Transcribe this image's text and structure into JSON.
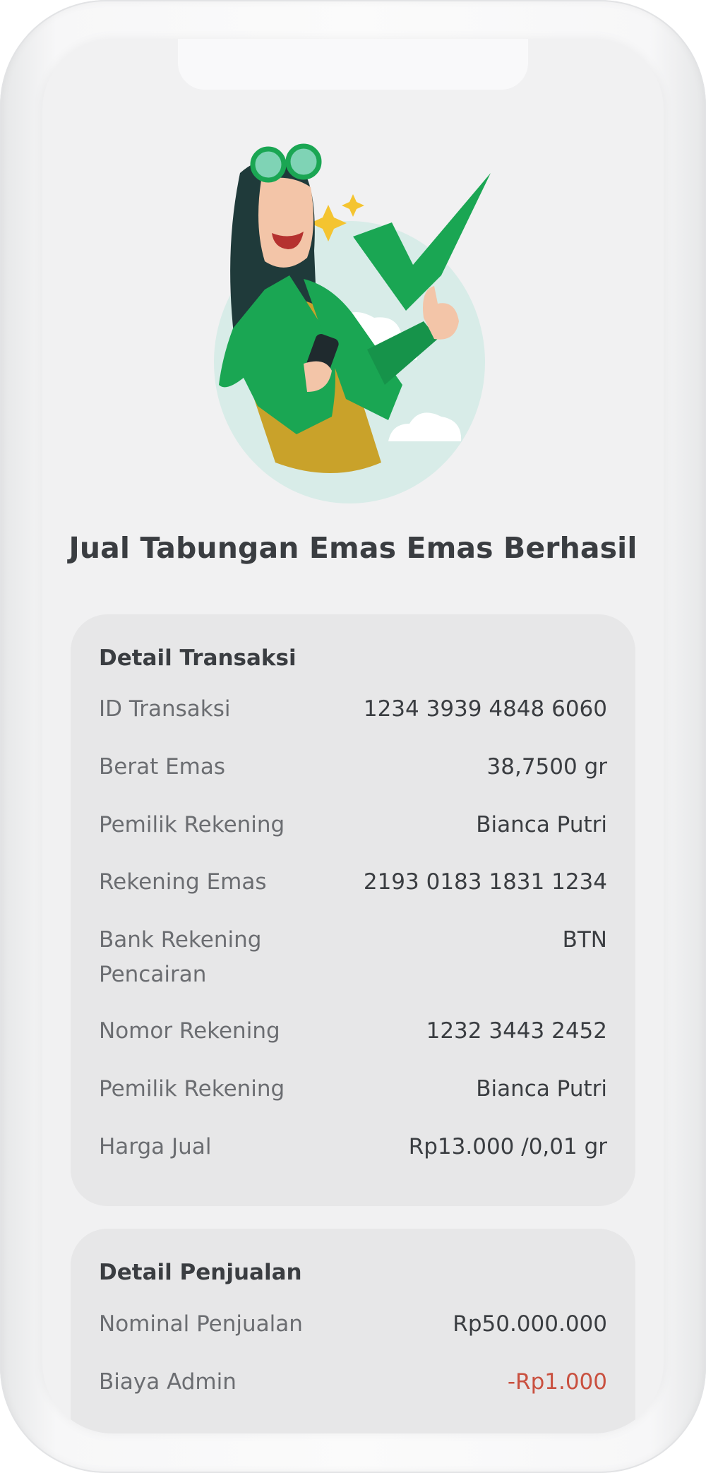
{
  "title": "Jual Tabungan Emas Emas Berhasil",
  "transaction": {
    "heading": "Detail Transaksi",
    "rows": [
      {
        "label": "ID Transaksi",
        "value": "1234 3939 4848 6060"
      },
      {
        "label": "Berat Emas",
        "value": "38,7500 gr"
      },
      {
        "label": "Pemilik Rekening",
        "value": "Bianca Putri"
      },
      {
        "label": "Rekening Emas",
        "value": "2193 0183 1831 1234"
      },
      {
        "label": "Bank Rekening Pencairan",
        "value": "BTN"
      },
      {
        "label": "Nomor Rekening",
        "value": "1232 3443 2452"
      },
      {
        "label": "Pemilik Rekening",
        "value": "Bianca Putri"
      },
      {
        "label": "Harga Jual",
        "value": "Rp13.000 /0,01 gr"
      }
    ]
  },
  "sale": {
    "heading": "Detail Penjualan",
    "rows": [
      {
        "label": "Nominal Penjualan",
        "value": "Rp50.000.000"
      },
      {
        "label": "Biaya Admin",
        "value": "-Rp1.000"
      }
    ]
  },
  "colors": {
    "accent_green": "#1aa653",
    "negative_red": "#c9503f",
    "text_dark": "#3a3d41",
    "text_muted": "#6b6d71"
  },
  "illustration_icon": "success-celebration-illustration"
}
